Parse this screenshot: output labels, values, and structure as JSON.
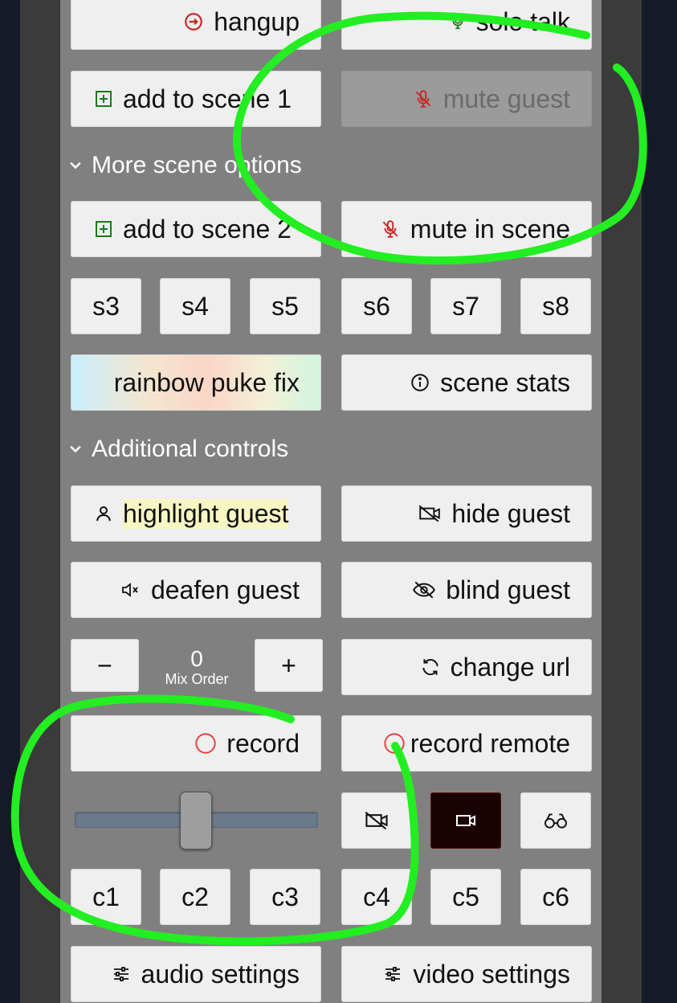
{
  "buttons": {
    "hangup": "hangup",
    "solo_talk": "solo talk",
    "add_scene_1": "add to scene 1",
    "mute_guest": "mute guest",
    "add_scene_2": "add to scene 2",
    "mute_in_scene": "mute in scene",
    "scenes": [
      "s3",
      "s4",
      "s5",
      "s6",
      "s7",
      "s8"
    ],
    "rainbow_fix": "rainbow puke fix",
    "scene_stats": "scene stats",
    "highlight_guest": "highlight guest",
    "hide_guest": "hide guest",
    "deafen_guest": "deafen guest",
    "blind_guest": "blind guest",
    "minus": "−",
    "plus": "+",
    "change_url": "change url",
    "record": "record",
    "record_remote": "record remote",
    "cameras": [
      "c1",
      "c2",
      "c3",
      "c4",
      "c5",
      "c6"
    ],
    "audio_settings": "audio settings",
    "video_settings": "video settings"
  },
  "sections": {
    "more_scene_options": "More scene options",
    "additional_controls": "Additional controls"
  },
  "mix_order": {
    "value": "0",
    "label": "Mix Order"
  },
  "volume_slider": {
    "value": 0.5
  },
  "colors": {
    "hangup_icon": "#c62828",
    "mute_icon": "#c62828",
    "add_icon": "#1b7a1b",
    "highlight_bg": "#f8f7c4",
    "record_icon": "#e53935",
    "annotation": "#22ee22",
    "active_camera_bg": "#1a0202"
  },
  "icons": {
    "hangup": "hangup-circle-arrow-icon",
    "solo_talk": "microphone-icon",
    "add_scene": "plus-square-icon",
    "mute": "microphone-slash-icon",
    "info": "info-circle-icon",
    "highlight": "person-icon",
    "hide": "video-camera-slash-icon",
    "deafen": "speaker-mute-icon",
    "blind": "eye-slash-icon",
    "change_url": "refresh-icon",
    "record": "record-circle-icon",
    "camera_off": "video-camera-slash-icon",
    "camera_on": "video-camera-icon",
    "binoculars": "binoculars-icon",
    "settings": "sliders-icon"
  }
}
